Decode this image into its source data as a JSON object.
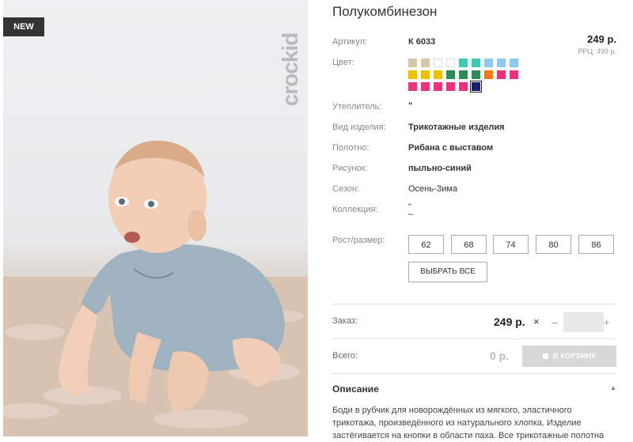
{
  "badge": "NEW",
  "brand": "crockid",
  "product": {
    "title": "Полукомбинезон",
    "price": "249 р.",
    "rrp": "РРЦ: 499 р."
  },
  "attributes": {
    "article_label": "Артикул:",
    "article_value": "К 6033",
    "color_label": "Цвет:",
    "insulation_label": "Утеплитель:",
    "insulation_value": "\"",
    "type_label": "Вид изделия:",
    "type_value": "Трикотажные изделия",
    "fabric_label": "Полотно:",
    "fabric_value": "Рибана с выставом",
    "pattern_label": "Рисунок:",
    "pattern_value": "пыльно-синий",
    "season_label": "Сезон:",
    "season_value": "Осень-Зима",
    "collection_label": "Коллекция:",
    "collection_value_1": "\"",
    "collection_value_2": "–"
  },
  "swatches": [
    [
      "#d6c7a8",
      "#d6c7a8",
      "#ffffff",
      "#ffffff",
      "#3fcab2",
      "#3fcab2",
      "#8ec9f0",
      "#8ec9f0",
      "#8ec9f0"
    ],
    [
      "#f0c000",
      "#f0c000",
      "#f0c000",
      "#2e8b57",
      "#2e8b57",
      "#2e8b57",
      "#f07b1a",
      "#e8337a",
      "#e8337a"
    ],
    [
      "#e8337a",
      "#e8337a",
      "#e8337a",
      "#e8337a",
      "#e8337a",
      "#1c1c6e"
    ]
  ],
  "sizes": {
    "label": "Рост/размер:",
    "values": [
      "62",
      "68",
      "74",
      "80",
      "86"
    ],
    "select_all": "ВЫБРАТЬ ВСЕ"
  },
  "order": {
    "label": "Заказ:",
    "price": "249 р.",
    "times": "×",
    "minus": "–",
    "plus": "+",
    "quantity": ""
  },
  "total": {
    "label": "Всего:",
    "value": "0 р.",
    "cart_button": "В КОРЗИНУ"
  },
  "description": {
    "title": "Описание",
    "line_1": "Боди в рубчик для новорождённых из мягкого, эластичного",
    "line_2": "трикотажа, произведённого из натурального хлопка. Изделие",
    "line_3": "застёгивается на кнопки в области паха. Все трикотажные полотна"
  }
}
